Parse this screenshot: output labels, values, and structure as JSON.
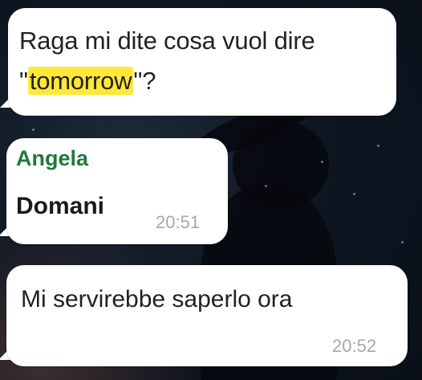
{
  "colors": {
    "bubble_bg": "#ffffff",
    "highlight": "#ffe838",
    "sender_name": "#1f7a3a",
    "timestamp": "#a8a8a8",
    "wallpaper": "#0f1622"
  },
  "messages": [
    {
      "text_part1": "Raga mi dite cosa vuol dire",
      "quote_open": "\"",
      "highlighted_word": "tomorrow",
      "quote_close": "\"?"
    },
    {
      "sender": "Angela",
      "text": "Domani",
      "time": "20:51"
    },
    {
      "text": "Mi servirebbe saperlo ora",
      "time": "20:52"
    }
  ]
}
